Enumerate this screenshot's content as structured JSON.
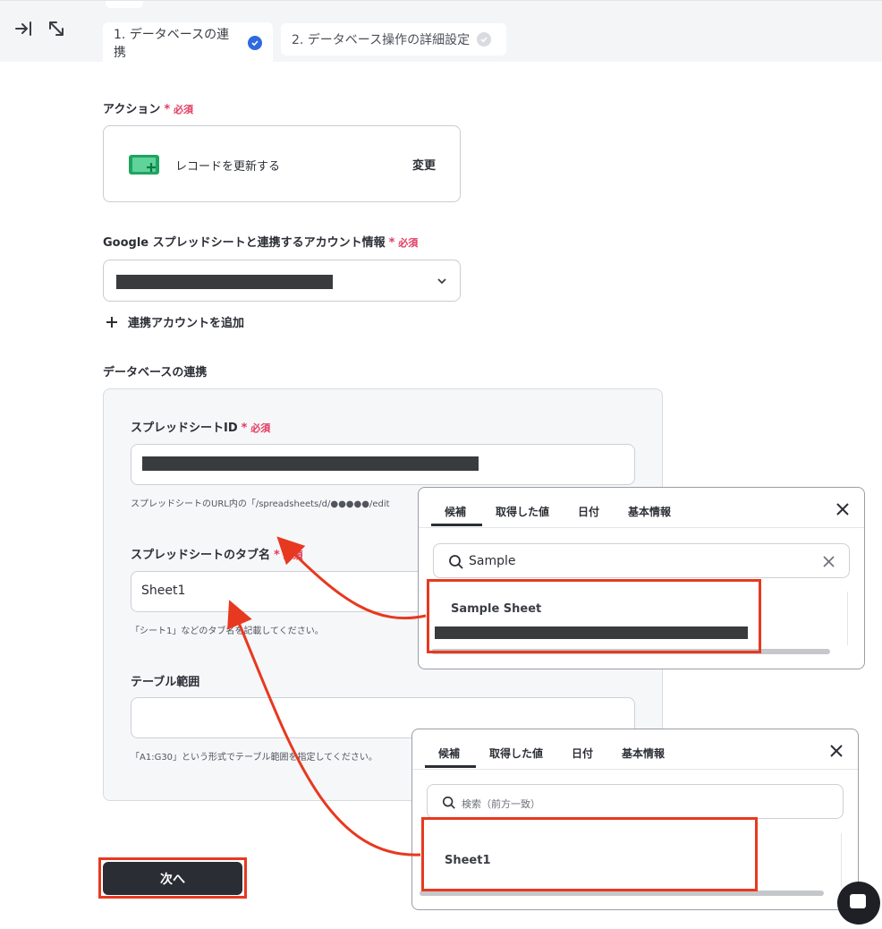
{
  "tabs": [
    {
      "label": "1. データベースの連携",
      "status": "complete"
    },
    {
      "label": "2. データベース操作の詳細設定",
      "status": "incomplete"
    }
  ],
  "required_mark": "必須",
  "action": {
    "label": "アクション",
    "name": "レコードを更新する",
    "change_label": "変更"
  },
  "account": {
    "label": "Google スプレッドシートと連携するアカウント情報",
    "add_label": "連携アカウントを追加"
  },
  "database": {
    "section_label": "データベースの連携",
    "spreadsheet_id": {
      "label": "スプレッドシートID",
      "help": "スプレッドシートのURL内の「/spreadsheets/d/●●●●●/edit"
    },
    "tab_name": {
      "label": "スプレッドシートのタブ名",
      "value": "Sheet1",
      "help": "「シート1」などのタブ名を記載してください。"
    },
    "table_range": {
      "label": "テーブル範囲",
      "value": "",
      "help": "「A1:G30」という形式でテーブル範囲を指定してください。"
    }
  },
  "popup1": {
    "tabs": [
      "候補",
      "取得した値",
      "日付",
      "基本情報"
    ],
    "search_value": "Sample",
    "result": "Sample Sheet"
  },
  "popup2": {
    "tabs": [
      "候補",
      "取得した値",
      "日付",
      "基本情報"
    ],
    "search_placeholder": "検索（前方一致）",
    "result": "Sheet1"
  },
  "next_button": "次へ",
  "colors": {
    "accent_blue": "#2f6ae0",
    "required_red": "#e33a5f",
    "highlight_red": "#e7391f",
    "button_dark": "#2a2d34"
  }
}
